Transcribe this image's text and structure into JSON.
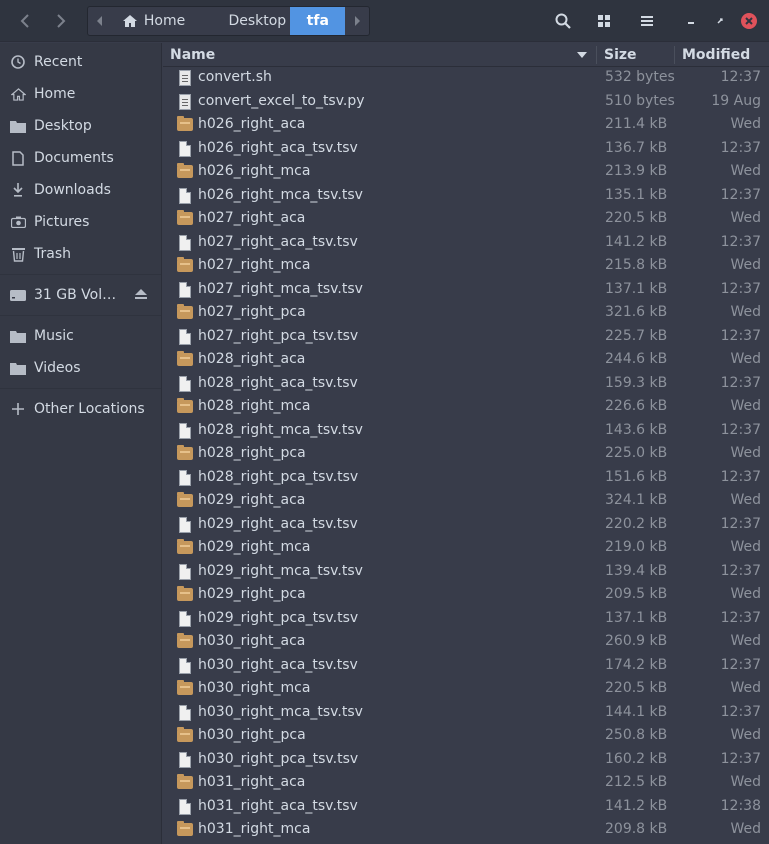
{
  "header": {
    "back_icon": "back-icon",
    "forward_icon": "forward-icon",
    "crumbs": [
      "Home",
      "Desktop",
      "tfa"
    ],
    "search_icon": "search-icon",
    "view_icon": "grid-view-icon",
    "menu_icon": "hamburger-menu-icon",
    "accent": "#5294e2",
    "close_color": "#e0525b"
  },
  "sidebar": {
    "items": [
      {
        "label": "Recent",
        "icon": "clock-icon"
      },
      {
        "label": "Home",
        "icon": "home-icon"
      },
      {
        "label": "Desktop",
        "icon": "folder-icon"
      },
      {
        "label": "Documents",
        "icon": "document-icon"
      },
      {
        "label": "Downloads",
        "icon": "download-icon"
      },
      {
        "label": "Pictures",
        "icon": "camera-icon"
      },
      {
        "label": "Trash",
        "icon": "trash-icon"
      },
      {
        "label": "31 GB Vol…",
        "icon": "drive-icon"
      },
      {
        "label": "Music",
        "icon": "folder-icon"
      },
      {
        "label": "Videos",
        "icon": "folder-icon"
      },
      {
        "label": "Other Locations",
        "icon": "plus-icon"
      }
    ]
  },
  "columns": {
    "name": "Name",
    "size": "Size",
    "modified": "Modified"
  },
  "files": [
    {
      "name": "convert.sh",
      "size": "532 bytes",
      "modified": "12:37",
      "type": "script"
    },
    {
      "name": "convert_excel_to_tsv.py",
      "size": "510 bytes",
      "modified": "19 Aug",
      "type": "script"
    },
    {
      "name": "h026_right_aca",
      "size": "211.4 kB",
      "modified": "Wed",
      "type": "archive"
    },
    {
      "name": "h026_right_aca_tsv.tsv",
      "size": "136.7 kB",
      "modified": "12:37",
      "type": "text"
    },
    {
      "name": "h026_right_mca",
      "size": "213.9 kB",
      "modified": "Wed",
      "type": "archive"
    },
    {
      "name": "h026_right_mca_tsv.tsv",
      "size": "135.1 kB",
      "modified": "12:37",
      "type": "text"
    },
    {
      "name": "h027_right_aca",
      "size": "220.5 kB",
      "modified": "Wed",
      "type": "archive"
    },
    {
      "name": "h027_right_aca_tsv.tsv",
      "size": "141.2 kB",
      "modified": "12:37",
      "type": "text"
    },
    {
      "name": "h027_right_mca",
      "size": "215.8 kB",
      "modified": "Wed",
      "type": "archive"
    },
    {
      "name": "h027_right_mca_tsv.tsv",
      "size": "137.1 kB",
      "modified": "12:37",
      "type": "text"
    },
    {
      "name": "h027_right_pca",
      "size": "321.6 kB",
      "modified": "Wed",
      "type": "archive"
    },
    {
      "name": "h027_right_pca_tsv.tsv",
      "size": "225.7 kB",
      "modified": "12:37",
      "type": "text"
    },
    {
      "name": "h028_right_aca",
      "size": "244.6 kB",
      "modified": "Wed",
      "type": "archive"
    },
    {
      "name": "h028_right_aca_tsv.tsv",
      "size": "159.3 kB",
      "modified": "12:37",
      "type": "text"
    },
    {
      "name": "h028_right_mca",
      "size": "226.6 kB",
      "modified": "Wed",
      "type": "archive"
    },
    {
      "name": "h028_right_mca_tsv.tsv",
      "size": "143.6 kB",
      "modified": "12:37",
      "type": "text"
    },
    {
      "name": "h028_right_pca",
      "size": "225.0 kB",
      "modified": "Wed",
      "type": "archive"
    },
    {
      "name": "h028_right_pca_tsv.tsv",
      "size": "151.6 kB",
      "modified": "12:37",
      "type": "text"
    },
    {
      "name": "h029_right_aca",
      "size": "324.1 kB",
      "modified": "Wed",
      "type": "archive"
    },
    {
      "name": "h029_right_aca_tsv.tsv",
      "size": "220.2 kB",
      "modified": "12:37",
      "type": "text"
    },
    {
      "name": "h029_right_mca",
      "size": "219.0 kB",
      "modified": "Wed",
      "type": "archive"
    },
    {
      "name": "h029_right_mca_tsv.tsv",
      "size": "139.4 kB",
      "modified": "12:37",
      "type": "text"
    },
    {
      "name": "h029_right_pca",
      "size": "209.5 kB",
      "modified": "Wed",
      "type": "archive"
    },
    {
      "name": "h029_right_pca_tsv.tsv",
      "size": "137.1 kB",
      "modified": "12:37",
      "type": "text"
    },
    {
      "name": "h030_right_aca",
      "size": "260.9 kB",
      "modified": "Wed",
      "type": "archive"
    },
    {
      "name": "h030_right_aca_tsv.tsv",
      "size": "174.2 kB",
      "modified": "12:37",
      "type": "text"
    },
    {
      "name": "h030_right_mca",
      "size": "220.5 kB",
      "modified": "Wed",
      "type": "archive"
    },
    {
      "name": "h030_right_mca_tsv.tsv",
      "size": "144.1 kB",
      "modified": "12:37",
      "type": "text"
    },
    {
      "name": "h030_right_pca",
      "size": "250.8 kB",
      "modified": "Wed",
      "type": "archive"
    },
    {
      "name": "h030_right_pca_tsv.tsv",
      "size": "160.2 kB",
      "modified": "12:37",
      "type": "text"
    },
    {
      "name": "h031_right_aca",
      "size": "212.5 kB",
      "modified": "Wed",
      "type": "archive"
    },
    {
      "name": "h031_right_aca_tsv.tsv",
      "size": "141.2 kB",
      "modified": "12:38",
      "type": "text"
    },
    {
      "name": "h031_right_mca",
      "size": "209.8 kB",
      "modified": "Wed",
      "type": "archive"
    }
  ]
}
